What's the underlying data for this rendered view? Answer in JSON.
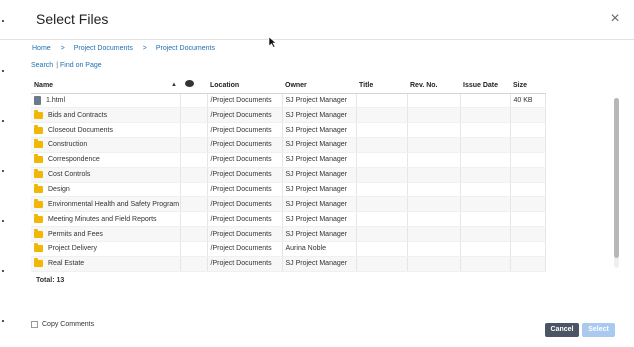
{
  "dialog": {
    "title": "Select Files",
    "close_icon": "×"
  },
  "breadcrumb": [
    {
      "label": "Home"
    },
    {
      "label": "Project Documents"
    },
    {
      "label": "Project Documents"
    }
  ],
  "breadcrumb_separator": ">",
  "links": {
    "search": "Search",
    "find_on_page": "Find on Page",
    "pipe": "|"
  },
  "table": {
    "columns": [
      {
        "label": "Name"
      },
      {
        "label": ""
      },
      {
        "label": "Location"
      },
      {
        "label": "Owner"
      },
      {
        "label": "Title"
      },
      {
        "label": "Rev. No."
      },
      {
        "label": "Issue Date"
      },
      {
        "label": "Size"
      }
    ],
    "rows": [
      {
        "icon": "file-icon",
        "name": "1.html",
        "location": "/Project Documents",
        "owner": "SJ Project Manager",
        "title": "",
        "rev": "",
        "issue_date": "",
        "size": "40 KB"
      },
      {
        "icon": "folder-icon",
        "name": "Bids and Contracts",
        "location": "/Project Documents",
        "owner": "SJ Project Manager",
        "title": "",
        "rev": "",
        "issue_date": "",
        "size": ""
      },
      {
        "icon": "folder-icon",
        "name": "Closeout Documents",
        "location": "/Project Documents",
        "owner": "SJ Project Manager",
        "title": "",
        "rev": "",
        "issue_date": "",
        "size": ""
      },
      {
        "icon": "folder-icon",
        "name": "Construction",
        "location": "/Project Documents",
        "owner": "SJ Project Manager",
        "title": "",
        "rev": "",
        "issue_date": "",
        "size": ""
      },
      {
        "icon": "folder-icon",
        "name": "Correspondence",
        "location": "/Project Documents",
        "owner": "SJ Project Manager",
        "title": "",
        "rev": "",
        "issue_date": "",
        "size": ""
      },
      {
        "icon": "folder-icon",
        "name": "Cost Controls",
        "location": "/Project Documents",
        "owner": "SJ Project Manager",
        "title": "",
        "rev": "",
        "issue_date": "",
        "size": ""
      },
      {
        "icon": "folder-icon",
        "name": "Design",
        "location": "/Project Documents",
        "owner": "SJ Project Manager",
        "title": "",
        "rev": "",
        "issue_date": "",
        "size": ""
      },
      {
        "icon": "folder-icon",
        "name": "Environmental Health and Safety Program",
        "location": "/Project Documents",
        "owner": "SJ Project Manager",
        "title": "",
        "rev": "",
        "issue_date": "",
        "size": ""
      },
      {
        "icon": "folder-icon",
        "name": "Meeting Minutes and Field Reports",
        "location": "/Project Documents",
        "owner": "SJ Project Manager",
        "title": "",
        "rev": "",
        "issue_date": "",
        "size": ""
      },
      {
        "icon": "folder-icon",
        "name": "Permits and Fees",
        "location": "/Project Documents",
        "owner": "SJ Project Manager",
        "title": "",
        "rev": "",
        "issue_date": "",
        "size": ""
      },
      {
        "icon": "folder-icon",
        "name": "Project Delivery",
        "location": "/Project Documents",
        "owner": "Aurina Noble",
        "title": "",
        "rev": "",
        "issue_date": "",
        "size": ""
      },
      {
        "icon": "folder-icon",
        "name": "Real Estate",
        "location": "/Project Documents",
        "owner": "SJ Project Manager",
        "title": "",
        "rev": "",
        "issue_date": "",
        "size": ""
      }
    ]
  },
  "total": "Total: 13",
  "copy_comments": {
    "label": "Copy Comments",
    "checked": false
  },
  "buttons": {
    "cancel": "Cancel",
    "select": "Select"
  },
  "colors": {
    "link": "#1f6fb2",
    "folder": "#f2b705",
    "cancel_bg": "#4b5563",
    "select_bg_disabled": "#a9c9ef"
  }
}
